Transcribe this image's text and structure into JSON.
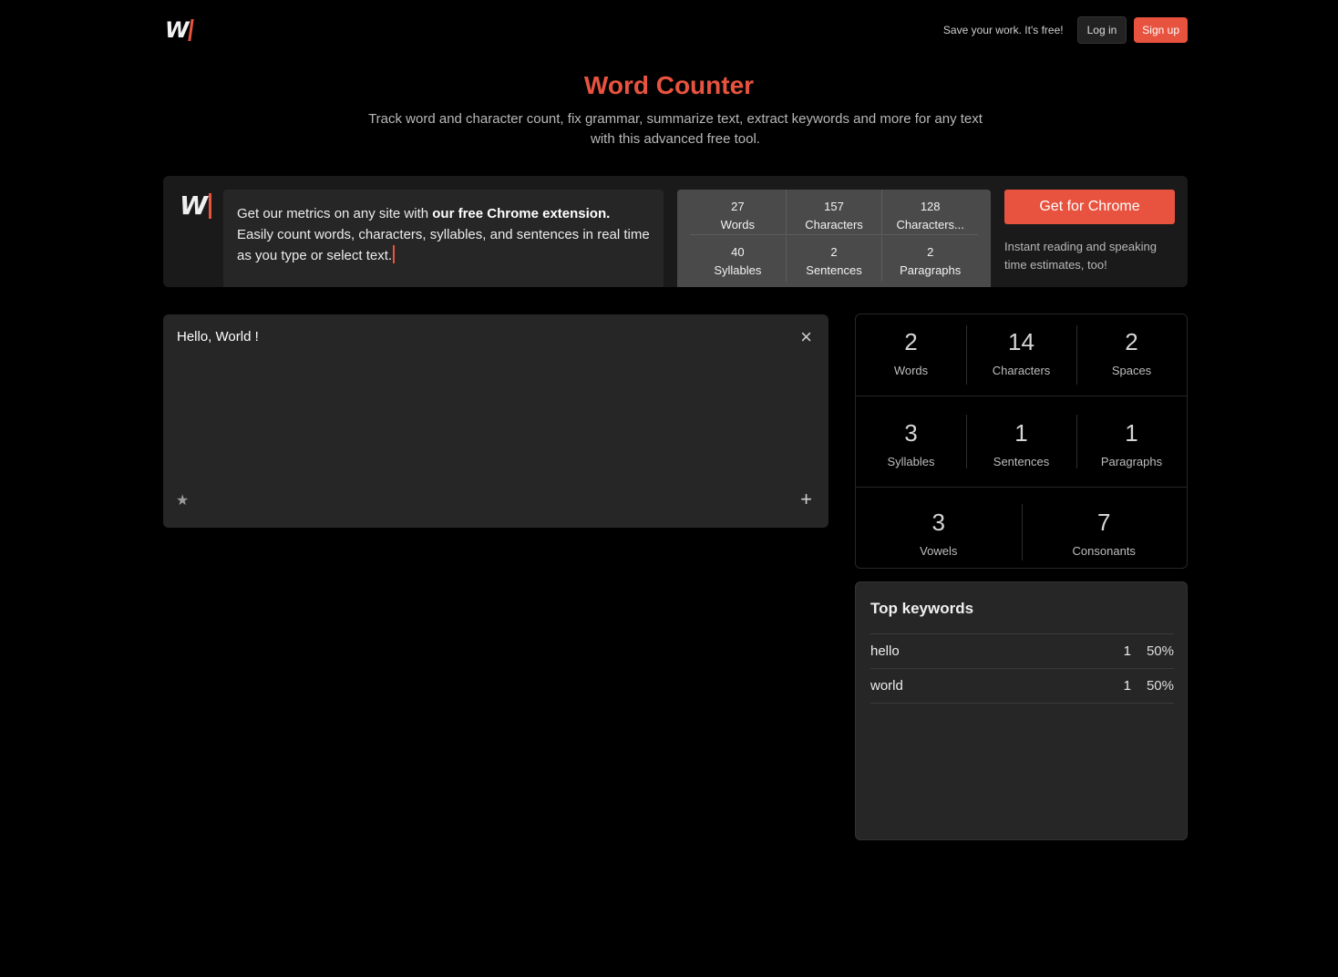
{
  "header": {
    "logo_text": "W",
    "save_note": "Save your work. It's free!",
    "login_label": "Log in",
    "signup_label": "Sign up"
  },
  "hero": {
    "title": "Word Counter",
    "subtitle": "Track word and character count, fix grammar, summarize text, extract keywords and more for any text with this advanced free tool."
  },
  "promo": {
    "logo_text": "W",
    "text_before": "Get our metrics on any site with ",
    "text_bold": "our free Chrome extension.",
    "text_after": " Easily count words, characters, syllables, and sentences in real time as you type or select text.",
    "mini_stats": [
      {
        "value": "27",
        "label": "Words"
      },
      {
        "value": "157",
        "label": "Characters"
      },
      {
        "value": "128",
        "label": "Characters..."
      },
      {
        "value": "40",
        "label": "Syllables"
      },
      {
        "value": "2",
        "label": "Sentences"
      },
      {
        "value": "2",
        "label": "Paragraphs"
      }
    ],
    "chrome_button": "Get for Chrome",
    "chrome_note": "Instant reading and speaking time estimates, too!"
  },
  "editor": {
    "text": "Hello, World !",
    "close_icon": "×",
    "star_icon": "★",
    "plus_icon": "+"
  },
  "stats": [
    {
      "value": "2",
      "label": "Words"
    },
    {
      "value": "14",
      "label": "Characters"
    },
    {
      "value": "2",
      "label": "Spaces"
    },
    {
      "value": "3",
      "label": "Syllables"
    },
    {
      "value": "1",
      "label": "Sentences"
    },
    {
      "value": "1",
      "label": "Paragraphs"
    },
    {
      "value": "3",
      "label": "Vowels"
    },
    {
      "value": "7",
      "label": "Consonants"
    }
  ],
  "keywords": {
    "title": "Top keywords",
    "rows": [
      {
        "word": "hello",
        "count": "1",
        "percent": "50%"
      },
      {
        "word": "world",
        "count": "1",
        "percent": "50%"
      }
    ]
  },
  "colors": {
    "accent": "#e8533f",
    "background": "#000000",
    "panel": "#262626"
  }
}
